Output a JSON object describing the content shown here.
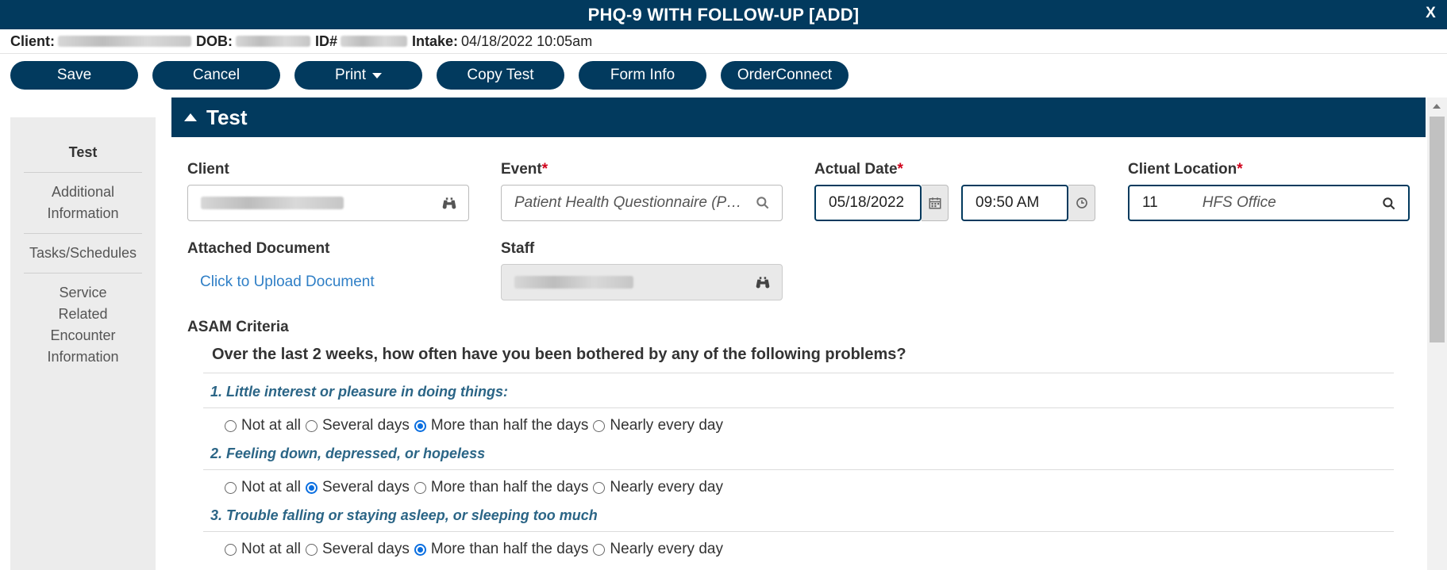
{
  "window": {
    "title": "PHQ-9 WITH FOLLOW-UP [ADD]",
    "close_label": "X"
  },
  "info": {
    "client_label": "Client:",
    "dob_label": "DOB:",
    "id_label": "ID#",
    "intake_label": "Intake:",
    "intake_value": "04/18/2022 10:05am"
  },
  "toolbar": {
    "save": "Save",
    "cancel": "Cancel",
    "print": "Print",
    "copy_test": "Copy Test",
    "form_info": "Form Info",
    "order_connect": "OrderConnect"
  },
  "nav": {
    "items": [
      {
        "label": "Test"
      },
      {
        "label": "Additional Information"
      },
      {
        "label": "Tasks/Schedules"
      },
      {
        "label": "Service Related Encounter Information"
      }
    ]
  },
  "section": {
    "title": "Test"
  },
  "form": {
    "client_label": "Client",
    "event_label": "Event",
    "event_value": "Patient Health Questionnaire (PH...",
    "actual_date_label": "Actual Date",
    "date_value": "05/18/2022",
    "time_value": "09:50 AM",
    "client_location_label": "Client Location",
    "location_code": "11",
    "location_name": "HFS Office",
    "attached_document_label": "Attached Document",
    "upload_link": "Click to Upload Document",
    "staff_label": "Staff",
    "required_mark": "*"
  },
  "asam": {
    "label": "ASAM Criteria",
    "prompt": "Over the last 2 weeks, how often have you been bothered by any of the following problems?",
    "options": [
      "Not at all",
      "Several days",
      "More than half the days",
      "Nearly every day"
    ],
    "questions": [
      {
        "text": "1. Little interest or pleasure in doing things:",
        "selected": 2
      },
      {
        "text": "2. Feeling down, depressed, or hopeless",
        "selected": 1
      },
      {
        "text": "3. Trouble falling or staying asleep, or sleeping too much",
        "selected": 2
      }
    ]
  },
  "icons": {
    "binoculars": "binoculars-icon",
    "search": "search-icon",
    "calendar": "calendar-icon",
    "clock": "clock-icon",
    "caret": "caret-down-icon",
    "collapse": "triangle-up-icon"
  },
  "colors": {
    "primary": "#023a5e",
    "required": "#d0021b",
    "link": "#2f7fc6",
    "question": "#2b6586",
    "radio": "#0b6fe0"
  }
}
